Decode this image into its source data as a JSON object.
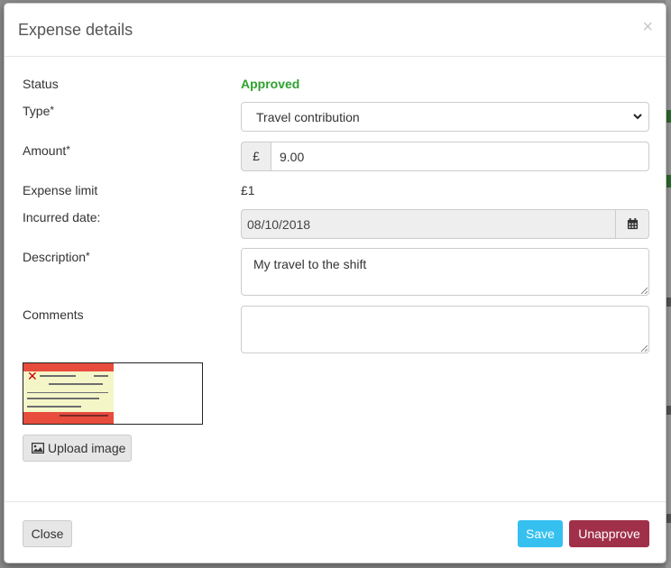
{
  "modal": {
    "title": "Expense details",
    "close_glyph": "×"
  },
  "fields": {
    "status": {
      "label": "Status",
      "value": "Approved",
      "color": "#2ea12e"
    },
    "type": {
      "label": "Type",
      "required": "*",
      "selected": "Travel contribution"
    },
    "amount": {
      "label": "Amount",
      "required": "*",
      "currency": "£",
      "value": "9.00"
    },
    "expense_limit": {
      "label": "Expense limit",
      "value": "£1"
    },
    "incurred_date": {
      "label": "Incurred date:",
      "value": "08/10/2018",
      "icon": "calendar-icon"
    },
    "description": {
      "label": "Description",
      "required": "*",
      "value": "My travel to the shift"
    },
    "comments": {
      "label": "Comments",
      "value": ""
    }
  },
  "attachment": {
    "thumbnail_icon": "receipt-thumbnail",
    "upload_label": "Upload image",
    "upload_icon": "image-icon"
  },
  "footer": {
    "close_label": "Close",
    "save_label": "Save",
    "unapprove_label": "Unapprove",
    "colors": {
      "save": "#35c0f0",
      "unapprove": "#a0304a"
    }
  }
}
